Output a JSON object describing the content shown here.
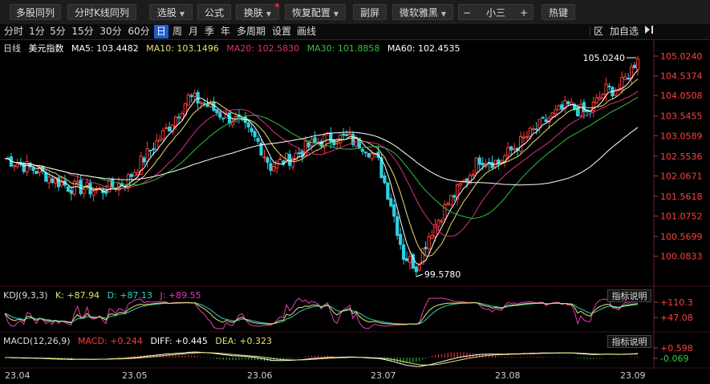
{
  "toolbar": {
    "multi_stock": "多股同列",
    "intraday_k": "分时K线同列",
    "select_stock": "选股",
    "formula": "公式",
    "skin": "换肤",
    "restore_config": "恢复配置",
    "sub_screen": "副屏",
    "font": "微软雅黑",
    "minus": "−",
    "font_size": "小三",
    "plus": "+",
    "hotkey": "热键"
  },
  "periods": [
    "分时",
    "1分",
    "5分",
    "15分",
    "30分",
    "60分",
    "日",
    "周",
    "月",
    "季",
    "年",
    "多周期",
    "设置",
    "画线"
  ],
  "active_period": "日",
  "right_tools": {
    "zone": "区",
    "add_fav": "加自选",
    "collapse_icon": "panel-collapse-icon"
  },
  "main": {
    "period_label": "日线",
    "name": "美元指数",
    "ma5": "MA5: 103.4482",
    "ma10": "MA10: 103.1496",
    "ma20": "MA20: 102.5830",
    "ma30": "MA30: 101.8858",
    "ma60": "MA60: 102.4535",
    "high_label": "105.0240",
    "low_label": "99.5780"
  },
  "colors": {
    "up": "#ff3b3b",
    "down": "#2fd0e0",
    "ma5": "#ffffff",
    "ma10": "#e8e070",
    "ma20": "#e0307a",
    "ma30": "#30c040",
    "ma60": "#ffffff"
  },
  "kdj": {
    "title": "KDJ(9,3,3)",
    "k": "K: +87.94",
    "d": "D: +87.13",
    "j": "J: +89.55",
    "button": "指标说明"
  },
  "macd": {
    "title": "MACD(12,26,9)",
    "macd": "MACD: +0.244",
    "diff": "DIFF: +0.445",
    "dea": "DEA: +0.323",
    "button": "指标说明"
  },
  "chart_data": {
    "type": "candlestick",
    "title": "美元指数 日线",
    "price_ticks": [
      105.024,
      104.5374,
      104.0508,
      103.5455,
      103.0589,
      102.5536,
      102.0671,
      101.5618,
      101.0752,
      100.5699,
      100.0833
    ],
    "kdj_ticks": [
      "+110.3",
      "+47.08"
    ],
    "macd_ticks": [
      "+0.598",
      "-0.069"
    ],
    "x_labels": [
      "23.04",
      "23.05",
      "23.06",
      "23.07",
      "23.08",
      "23.09"
    ],
    "high": 105.024,
    "low": 99.578,
    "price_range": [
      99.5,
      105.3
    ]
  }
}
